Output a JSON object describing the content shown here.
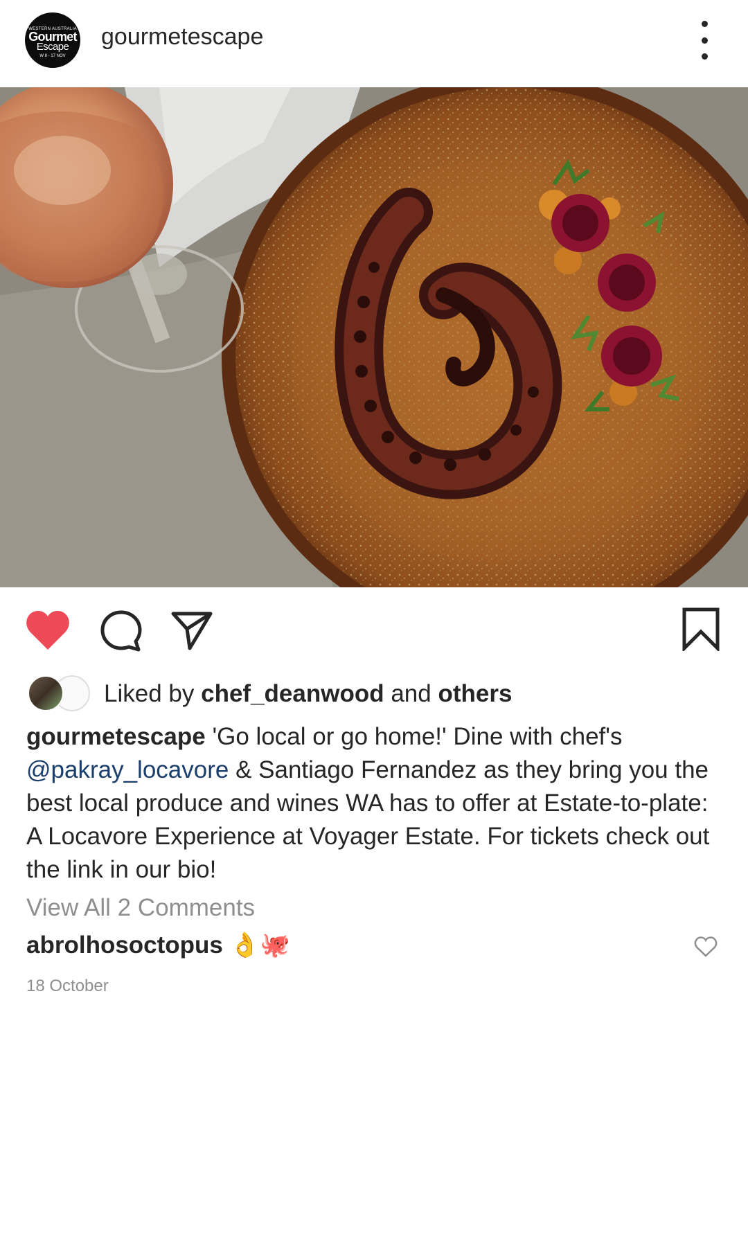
{
  "post": {
    "username": "gourmetescape",
    "avatar_lines": [
      "WESTERN AUSTRALIA",
      "Gourmet",
      "Escape",
      "W  8 - 17 NOV"
    ]
  },
  "image": {
    "description_icon": "octopus-dish-photo"
  },
  "actions": {
    "like_icon": "heart-filled-icon",
    "comment_icon": "comment-icon",
    "share_icon": "send-icon",
    "save_icon": "bookmark-icon",
    "like_color": "#ed4956"
  },
  "likes": {
    "prefix": "Liked by",
    "user": "chef_deanwood",
    "connector": "and",
    "others": "others"
  },
  "caption": {
    "author": "gourmetescape",
    "text_1": "'Go local or go home!' Dine with chef's",
    "mention": "@pakray_locavore",
    "text_2": "& Santiago Fernandez as they bring you the best local produce and wines WA has to offer at Estate-to-plate: A Locavore Experience at Voyager Estate. For tickets check out the link in our bio!"
  },
  "comments": {
    "view_all": "View All 2 Comments",
    "items": [
      {
        "author": "abrolhosoctopus",
        "text": "👌🐙"
      }
    ]
  },
  "date": "18 October"
}
